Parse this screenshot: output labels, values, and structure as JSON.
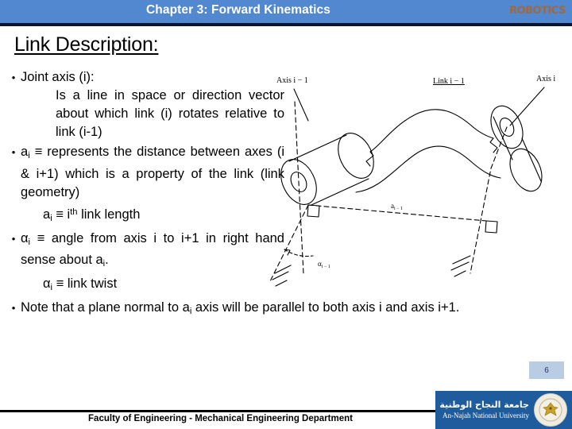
{
  "header": {
    "title": "Chapter 3: Forward Kinematics",
    "logo_text": "ROBOTICS",
    "bar_color": "#5288d0",
    "logo_color": "#9c6a42"
  },
  "slide": {
    "title": "Link Description:",
    "bullets": [
      {
        "id": "joint-axis",
        "marker": "•",
        "text": "Joint axis (i):",
        "sub_lines": [
          "Is a line in space or direction vector about which link (i) rotates relative to link (i-1)"
        ]
      },
      {
        "id": "a-distance",
        "marker": "•",
        "text_parts": {
          "lead": "a",
          "subscript": "i",
          "rest": " ≡ represents the distance between axes (i & i+1) which is a property of the link (link geometry)"
        }
      },
      {
        "id": "a-link-length",
        "marker": "",
        "text_parts": {
          "lead": "a",
          "subscript": "i",
          "rest": " ≡ i",
          "superscript": "th",
          "tail": " link length"
        }
      },
      {
        "id": "alpha-angle",
        "marker": "•",
        "text_parts": {
          "lead": "α",
          "subscript": "i",
          "rest": " ≡ angle from axis i to i+1 in right hand sense about a",
          "subscript2": "i",
          "tail": "."
        }
      },
      {
        "id": "alpha-link-twist",
        "marker": "",
        "text_parts": {
          "lead": "α",
          "subscript": "i",
          "rest": " ≡ link twist"
        }
      },
      {
        "id": "plane-normal-note",
        "marker": "•",
        "text_parts": {
          "lead": "Note that a plane normal to a",
          "subscript": "i",
          "rest": " axis will be parallel to both axis i and axis i+1."
        }
      }
    ]
  },
  "figure": {
    "caption_axis_left": "Axis i − 1",
    "caption_link": "Link i − 1",
    "caption_axis_right": "Axis i",
    "label_a": "a",
    "label_a_sub": "i − 1",
    "label_alpha": "α",
    "label_alpha_sub": "i − 1"
  },
  "page_number": "6",
  "footer": {
    "text": "Faculty of Engineering -  Mechanical Engineering Department",
    "university_arabic": "جامعة النجاح الوطنية",
    "university_english": "An-Najah National University",
    "logo_bg": "#1f5c9e"
  }
}
